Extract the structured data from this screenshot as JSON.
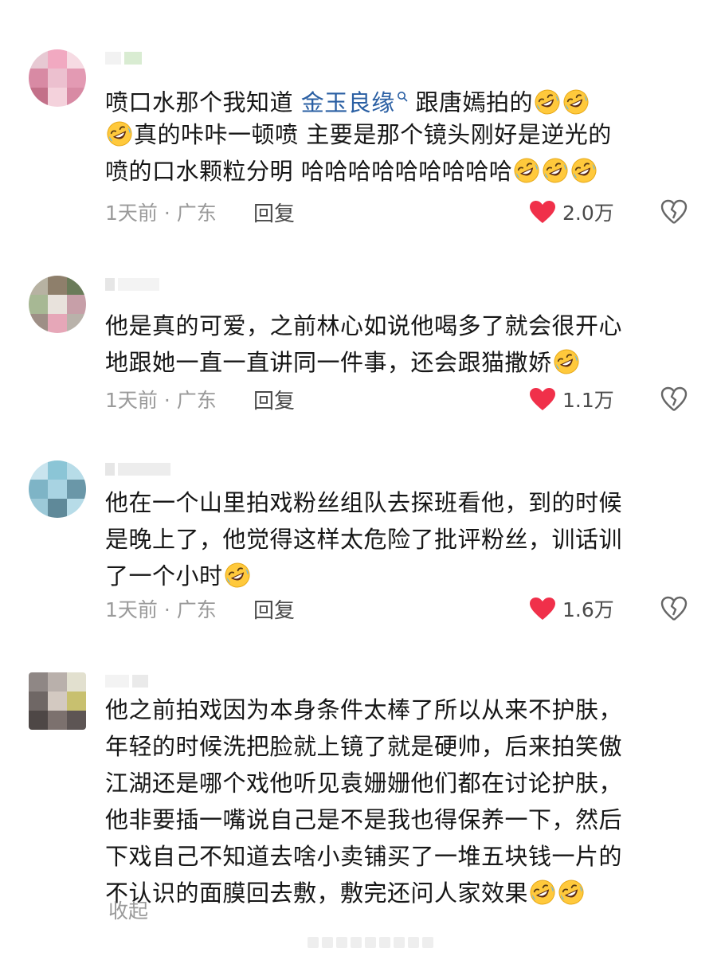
{
  "comments": [
    {
      "lines": [
        [
          "喷口水那个我知道 ",
          {
            "topic": "金玉良缘"
          },
          " 跟唐嫣拍的",
          "EMOJI",
          "EMOJI"
        ],
        [
          "EMOJI",
          "真的咔咔一顿喷 主要是那个镜头刚好是逆光的"
        ],
        [
          "喷的口水颗粒分明 哈哈哈哈哈哈哈哈哈",
          "EMOJI",
          "EMOJI",
          "EMOJI"
        ]
      ],
      "time": "1天前 · 广东",
      "reply": "回复",
      "likes": "2.0万"
    },
    {
      "lines": [
        [
          "他是真的可爱，之前林心如说他喝多了就会很开心"
        ],
        [
          "地跟她一直一直讲同一件事，还会跟猫撒娇",
          "EMOJI"
        ]
      ],
      "time": "1天前 · 广东",
      "reply": "回复",
      "likes": "1.1万"
    },
    {
      "lines": [
        [
          "他在一个山里拍戏粉丝组队去探班看他，到的时候"
        ],
        [
          "是晚上了，他觉得这样太危险了批评粉丝，训话训"
        ],
        [
          "了一个小时",
          "EMOJI"
        ]
      ],
      "time": "1天前 · 广东",
      "reply": "回复",
      "likes": "1.6万"
    },
    {
      "lines": [
        [
          "他之前拍戏因为本身条件太棒了所以从来不护肤，"
        ],
        [
          "年轻的时候洗把脸就上镜了就是硬帅，后来拍笑傲"
        ],
        [
          "江湖还是哪个戏他听见袁姗姗他们都在讨论护肤，"
        ],
        [
          "他非要插一嘴说自己是不是我也得保养一下，然后"
        ],
        [
          "下戏自己不知道去啥小卖铺买了一堆五块钱一片的"
        ],
        [
          "不认识的面膜回去敷，敷完还问人家效果",
          "EMOJI",
          "EMOJI"
        ]
      ],
      "collapse": "收起"
    }
  ],
  "icons": {
    "like": "heart-icon",
    "dislike": "broken-heart-icon",
    "emoji": "rolling-on-floor-laughing-emoji",
    "topic_search": "search-icon"
  },
  "colors": {
    "like": "#f0304a",
    "topic": "#2a5fa3",
    "meta": "#9a9a9a",
    "emoji_face": "#ffc93c"
  }
}
